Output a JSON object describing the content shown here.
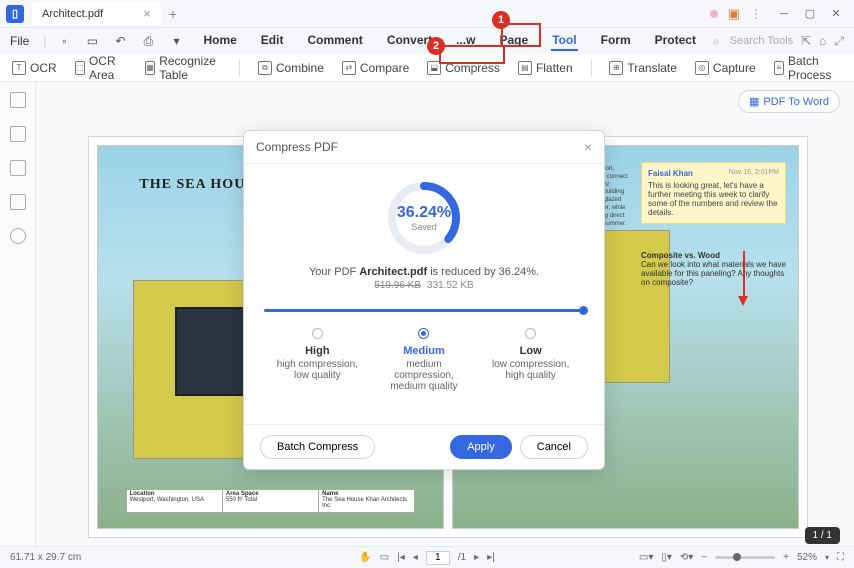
{
  "title": {
    "filename": "Architect.pdf"
  },
  "file_menu": "File",
  "menus": [
    "Home",
    "Edit",
    "Comment",
    "Convert",
    "...w",
    "Page",
    "Tool",
    "Form",
    "Protect"
  ],
  "search_ph": "Search Tools",
  "tools": {
    "ocr": "OCR",
    "ocr_area": "OCR Area",
    "recog": "Recognize Table",
    "combine": "Combine",
    "compare": "Compare",
    "compress": "Compress",
    "flatten": "Flatten",
    "translate": "Translate",
    "capture": "Capture",
    "batch": "Batch Process"
  },
  "pdf_to_word": "PDF To Word",
  "document": {
    "heading": "THE SEA HOUS",
    "info": {
      "loc_h": "Location",
      "loc_v": "Westport, Washington, USA",
      "area_h": "Area Space",
      "area_v": "550 ft² Total",
      "name_h": "Name",
      "name_v": "The Sea House Khan Architects Inc"
    },
    "right_text": "off-grid retreat in Westport, Washington. st place to connect with nature and stresses! electricity and passive building designs. This includes glazed areas that bring in winter, while an extended west-facing direct during evenings in the summer.",
    "sticky": {
      "name": "Faisal Khan",
      "date": "Nov 16, 2:01PM",
      "body": "This is looking great, let's have a further meeting this week to clarify some of the numbers and review the details."
    },
    "note_title": "Composite vs. Wood",
    "note_body": "Can we look into what materials we have available for this paneling? Any thoughts on composite?"
  },
  "dialog": {
    "title": "Compress PDF",
    "pct": "36.24%",
    "saved": "Saved",
    "line_a": "Your PDF ",
    "line_b": "Architect.pdf",
    "line_c": " is reduced by 36.24%.",
    "old": "519.96 KB",
    "new": "331.52 KB",
    "levels": {
      "high": {
        "t": "High",
        "d": "high compression, low quality"
      },
      "med": {
        "t": "Medium",
        "d": "medium compression, medium quality"
      },
      "low": {
        "t": "Low",
        "d": "low compression, high quality"
      }
    },
    "batch": "Batch Compress",
    "apply": "Apply",
    "cancel": "Cancel"
  },
  "footer": {
    "dims": "61.71 x 29.7 cm",
    "page": "1",
    "pages": "/1",
    "zoom": "52%",
    "pager": "1 / 1"
  },
  "annot": {
    "n1": "1",
    "n2": "2"
  }
}
